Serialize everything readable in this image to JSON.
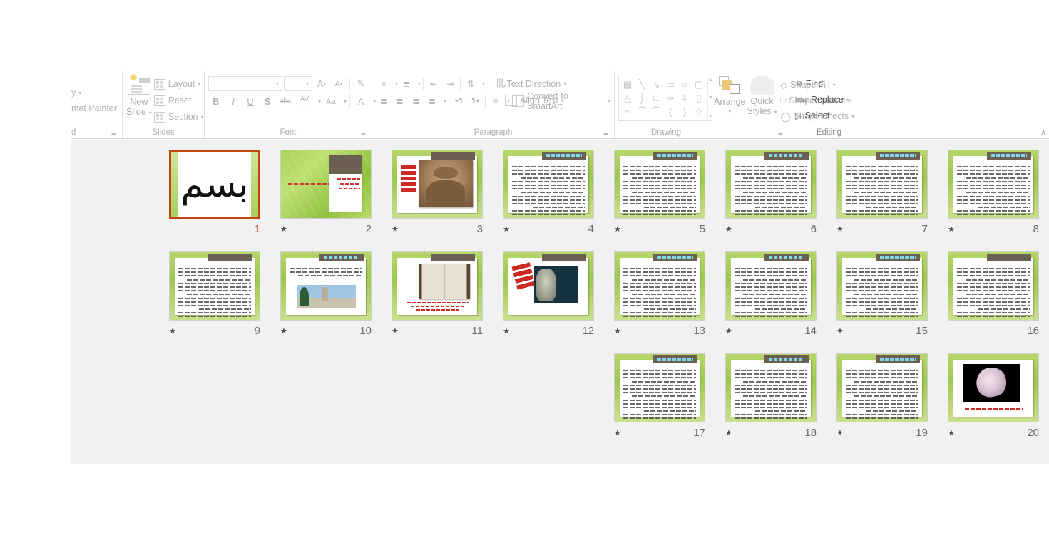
{
  "app": {
    "name": "PowerPoint Slide Sorter"
  },
  "ribbon": {
    "groups": {
      "clipboard": {
        "label": "d",
        "items": [
          {
            "name": "style-dropdown",
            "label": "y"
          },
          {
            "name": "format-painter",
            "label": "mat Painter"
          }
        ]
      },
      "slides": {
        "label": "Slides",
        "new_slide": "New\nSlide",
        "new_slide_line1": "New",
        "new_slide_line2": "Slide",
        "layout": "Layout",
        "reset": "Reset",
        "section": "Section"
      },
      "font": {
        "label": "Font",
        "font_name_value": "",
        "font_name_placeholder": "",
        "font_size_value": "",
        "grow_font": "A",
        "shrink_font": "A",
        "clear_formatting": "clear-formatting",
        "bold": "B",
        "italic": "I",
        "underline": "U",
        "shadow": "S",
        "strikethrough": "abc",
        "character_spacing": "AV",
        "change_case": "Aa",
        "font_color": "A"
      },
      "paragraph": {
        "label": "Paragraph",
        "text_direction": "Text Direction",
        "align_text": "Align Text",
        "convert_to_smartart": "Convert to SmartArt"
      },
      "drawing": {
        "label": "Drawing",
        "arrange": "Arrange",
        "quick_styles_line1": "Quick",
        "quick_styles_line2": "Styles",
        "shape_fill": "Shape Fill",
        "shape_outline": "Shape Outline",
        "shape_effects": "Shape Effects",
        "shapes": [
          "A=",
          "\\",
          "↘",
          "▭",
          "○",
          "▢",
          "△",
          "⌐",
          "└",
          "⇨",
          "⇩",
          "⌐",
          "∿",
          "⌢",
          "⌢",
          "{",
          "}",
          "☆"
        ]
      },
      "editing": {
        "label": "Editing",
        "find": "Find",
        "replace": "Replace",
        "select": "Select"
      }
    },
    "collapse_ribbon": "∧",
    "dialog_launcher": "⬌"
  },
  "slide_sorter": {
    "selected_slide": 1,
    "selection_color": "#c0450f",
    "rows": [
      {
        "slides": [
          {
            "number": "8",
            "art": "text",
            "title_style": "cyan",
            "transition": true,
            "selected": false
          },
          {
            "number": "7",
            "art": "text",
            "title_style": "cyan",
            "transition": true,
            "selected": false
          },
          {
            "number": "6",
            "art": "text",
            "title_style": "cyan",
            "transition": true,
            "selected": false
          },
          {
            "number": "5",
            "art": "text",
            "title_style": "cyan",
            "transition": true,
            "selected": false
          },
          {
            "number": "4",
            "art": "text",
            "title_style": "cyan",
            "transition": true,
            "selected": false
          },
          {
            "number": "3",
            "art": "portrait-sepia",
            "title_style": "plain",
            "transition": true,
            "selected": false
          },
          {
            "number": "2",
            "art": "green-title",
            "title_style": "none",
            "transition": true,
            "selected": false
          },
          {
            "number": "1",
            "art": "calligraphy",
            "title_style": "none",
            "transition": false,
            "selected": true
          }
        ]
      },
      {
        "slides": [
          {
            "number": "16",
            "art": "text",
            "title_style": "plain",
            "transition": false,
            "selected": false
          },
          {
            "number": "15",
            "art": "text",
            "title_style": "cyan",
            "transition": true,
            "selected": false
          },
          {
            "number": "14",
            "art": "text",
            "title_style": "cyan",
            "transition": true,
            "selected": false
          },
          {
            "number": "13",
            "art": "text",
            "title_style": "cyan",
            "transition": true,
            "selected": false
          },
          {
            "number": "12",
            "art": "portrait-dark",
            "title_style": "plain",
            "transition": true,
            "selected": false
          },
          {
            "number": "11",
            "art": "open-book",
            "title_style": "plain",
            "transition": true,
            "selected": false
          },
          {
            "number": "10",
            "art": "monument",
            "title_style": "cyan",
            "transition": true,
            "selected": false
          },
          {
            "number": "9",
            "art": "text",
            "title_style": "plain",
            "transition": true,
            "selected": false
          }
        ]
      },
      {
        "slides": [
          {
            "number": "20",
            "art": "statue",
            "title_style": "none",
            "transition": true,
            "selected": false
          },
          {
            "number": "19",
            "art": "text",
            "title_style": "cyan",
            "transition": true,
            "selected": false
          },
          {
            "number": "18",
            "art": "text",
            "title_style": "cyan",
            "transition": true,
            "selected": false
          },
          {
            "number": "17",
            "art": "text",
            "title_style": "cyan",
            "transition": true,
            "selected": false
          }
        ],
        "empty_leading": 4
      }
    ],
    "transition_marker": "★",
    "colors": {
      "workspace_background": "#f1f1f1",
      "thumbnail_border": "#cfcfcf",
      "slide_green": "#9ec84f",
      "slide_title_bar": "#6b6051",
      "slide_accent_red": "#cc2a22",
      "slide_title_text_cyan": "#7fd8ea"
    }
  }
}
